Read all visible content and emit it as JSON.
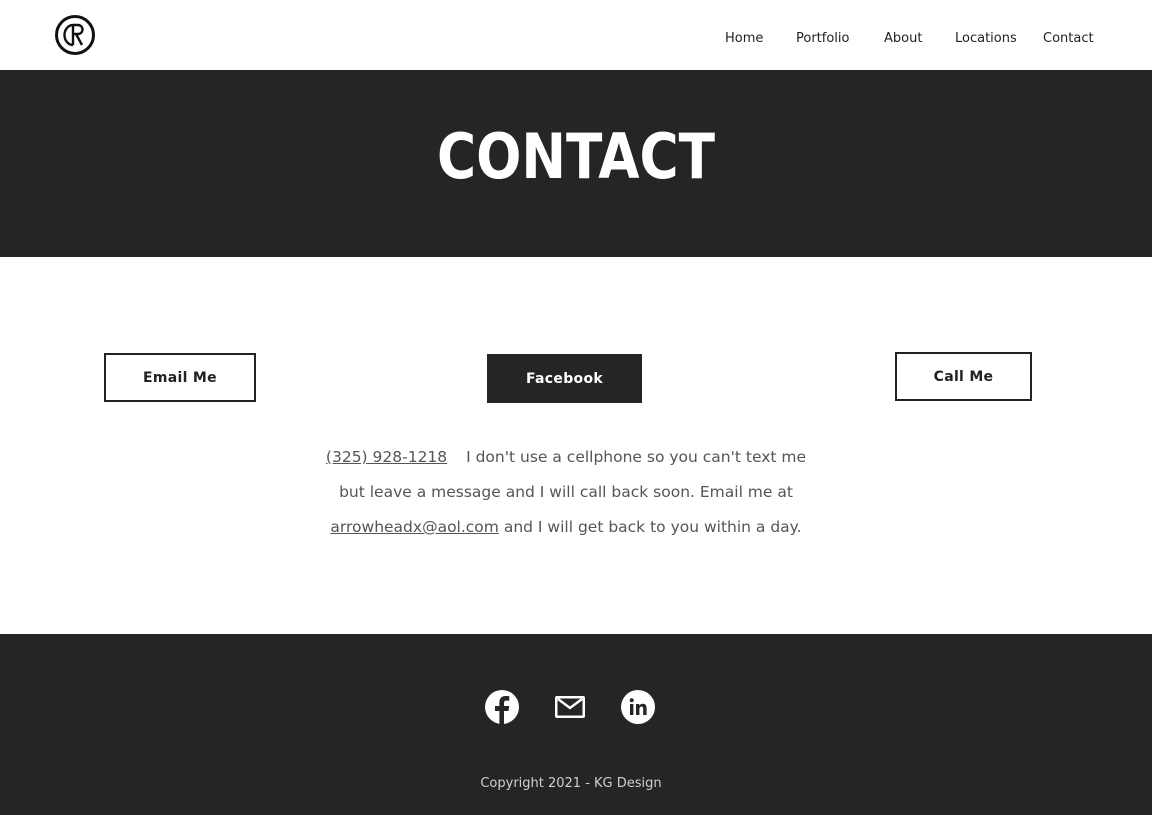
{
  "header": {
    "logo_text": "GR",
    "nav": [
      {
        "label": "Home"
      },
      {
        "label": "Portfolio"
      },
      {
        "label": "About"
      },
      {
        "label": "Locations"
      },
      {
        "label": "Contact"
      }
    ]
  },
  "hero": {
    "title": "CONTACT"
  },
  "buttons": {
    "email": "Email Me",
    "facebook": "Facebook",
    "call": "Call Me"
  },
  "contact": {
    "phone": "(325) 928-1218",
    "text_part1": "I don't use a cellphone so you can't text me but leave a message and I will call back soon. Email me at",
    "email": "arrowheadx@aol.com",
    "text_part2": "and I will get back to you within a day."
  },
  "footer": {
    "social_icons": [
      "facebook-icon",
      "mail-icon",
      "linkedin-icon"
    ],
    "copyright": "Copyright 2021 - KG Design"
  },
  "colors": {
    "dark": "#252525",
    "white": "#ffffff",
    "text_gray": "#555555"
  }
}
